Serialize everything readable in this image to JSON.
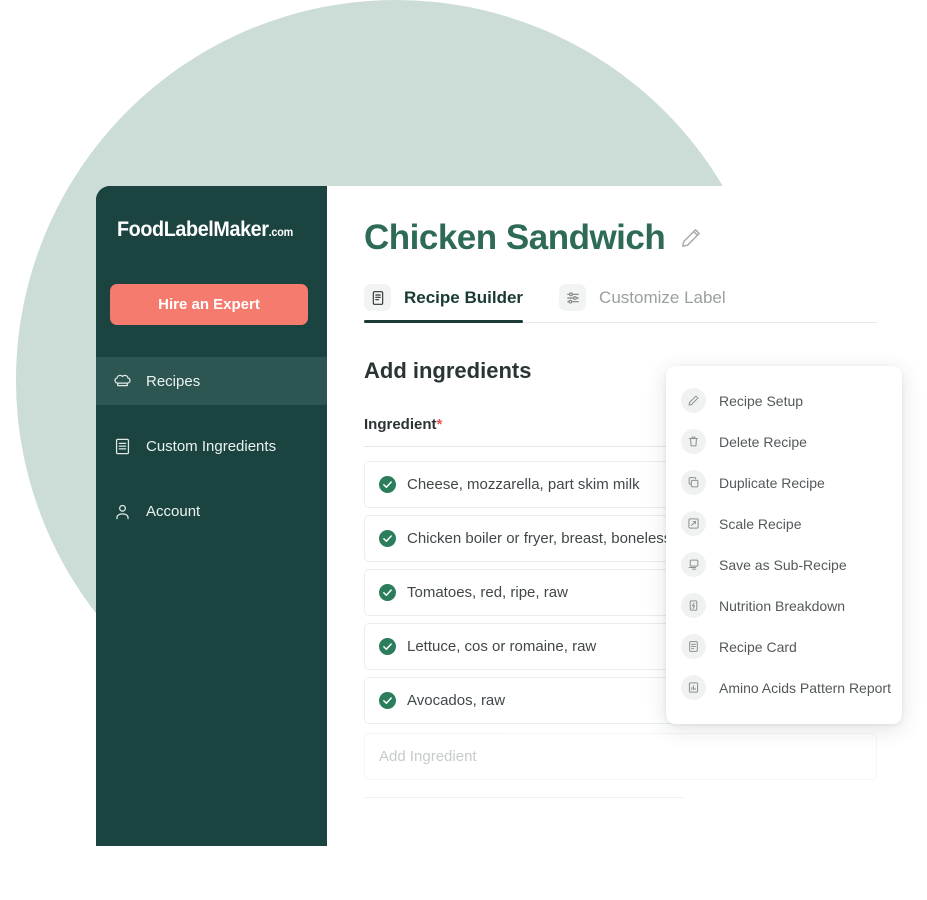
{
  "brand": {
    "logo_main": "FoodLabelMaker",
    "logo_suffix": ".com",
    "hire_expert_label": "Hire an Expert",
    "accent_coral": "#f47b6e",
    "sidebar_dark": "#1b4340",
    "circle_pale": "#ccdcd6",
    "title_green": "#2e6b55",
    "check_green": "#2c7d5b",
    "required_red": "#e2574c"
  },
  "sidebar": {
    "items": [
      {
        "label": "Recipes",
        "icon": "chef-hat-icon",
        "active": true
      },
      {
        "label": "Custom Ingredients",
        "icon": "list-icon",
        "active": false
      },
      {
        "label": "Account",
        "icon": "person-icon",
        "active": false
      }
    ]
  },
  "header": {
    "title": "Chicken Sandwich",
    "edit_icon": "pencil-icon"
  },
  "tabs": [
    {
      "label": "Recipe Builder",
      "icon": "document-icon",
      "active": true
    },
    {
      "label": "Customize Label",
      "icon": "sliders-icon",
      "active": false
    }
  ],
  "main": {
    "section_title": "Add ingredients",
    "column_header": "Ingredient",
    "required_marker": "*",
    "ingredients": [
      {
        "name": "Cheese, mozzarella, part skim milk",
        "status_icon": "check-circle-icon"
      },
      {
        "name": "Chicken boiler or fryer, breast, boneless",
        "status_icon": "check-circle-icon"
      },
      {
        "name": "Tomatoes, red, ripe, raw",
        "status_icon": "check-circle-icon"
      },
      {
        "name": "Lettuce, cos or romaine, raw",
        "status_icon": "check-circle-icon"
      },
      {
        "name": "Avocados, raw",
        "status_icon": "check-circle-icon"
      }
    ],
    "add_ingredient_placeholder": "Add Ingredient"
  },
  "context_menu": {
    "items": [
      {
        "label": "Recipe Setup",
        "icon": "pencil-icon"
      },
      {
        "label": "Delete Recipe",
        "icon": "trash-icon"
      },
      {
        "label": "Duplicate Recipe",
        "icon": "copy-icon"
      },
      {
        "label": "Scale Recipe",
        "icon": "expand-icon"
      },
      {
        "label": "Save as Sub-Recipe",
        "icon": "save-sub-icon"
      },
      {
        "label": "Nutrition Breakdown",
        "icon": "nutrition-icon"
      },
      {
        "label": "Recipe Card",
        "icon": "recipe-card-icon"
      },
      {
        "label": "Amino Acids Pattern Report",
        "icon": "report-chart-icon"
      }
    ]
  }
}
